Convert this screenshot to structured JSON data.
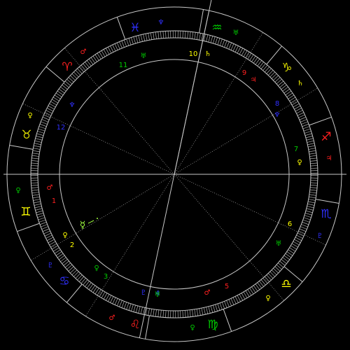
{
  "colors": {
    "background": "#000000",
    "ring": "#c8c8c8",
    "fire": "#ff2020",
    "earth": "#00cc00",
    "air": "#ffff00",
    "water": "#2020ff",
    "pointer": "#a0ff40"
  },
  "zodiac": [
    {
      "name": "aries",
      "glyph": "♈",
      "color": "#ff2020"
    },
    {
      "name": "taurus",
      "glyph": "♉",
      "color": "#dddd00"
    },
    {
      "name": "gemini",
      "glyph": "♊",
      "color": "#ffff00"
    },
    {
      "name": "cancer",
      "glyph": "♋",
      "color": "#3030ff"
    },
    {
      "name": "leo",
      "glyph": "♌",
      "color": "#ff2020"
    },
    {
      "name": "virgo",
      "glyph": "♍",
      "color": "#00cc00"
    },
    {
      "name": "libra",
      "glyph": "♎",
      "color": "#ffff00"
    },
    {
      "name": "scorpio",
      "glyph": "♏",
      "color": "#3030ff"
    },
    {
      "name": "sagittarius",
      "glyph": "♐",
      "color": "#ff2020"
    },
    {
      "name": "capricorn",
      "glyph": "♑",
      "color": "#dddd00"
    },
    {
      "name": "aquarius",
      "glyph": "♒",
      "color": "#00cc00"
    },
    {
      "name": "pisces",
      "glyph": "♓",
      "color": "#3030ff"
    }
  ],
  "houses": [
    {
      "number": "1",
      "color": "#ff2020"
    },
    {
      "number": "2",
      "color": "#ffff00"
    },
    {
      "number": "3",
      "color": "#00cc00"
    },
    {
      "number": "4",
      "color": "#3030ff"
    },
    {
      "number": "5",
      "color": "#ff2020"
    },
    {
      "number": "6",
      "color": "#ffff00"
    },
    {
      "number": "7",
      "color": "#00cc00"
    },
    {
      "number": "8",
      "color": "#3030ff"
    },
    {
      "number": "9",
      "color": "#ff2020"
    },
    {
      "number": "10",
      "color": "#ffff00"
    },
    {
      "number": "11",
      "color": "#00cc00"
    },
    {
      "number": "12",
      "color": "#3030ff"
    }
  ],
  "planets": [
    {
      "name": "mars",
      "glyph": "♂",
      "color": "#ff2020"
    },
    {
      "name": "venus",
      "glyph": "♀",
      "color": "#ffff00"
    },
    {
      "name": "mercury",
      "glyph": "☿",
      "color": "#a0ff40"
    },
    {
      "name": "saturn",
      "glyph": "♄",
      "color": "#ffff00"
    },
    {
      "name": "jupiter",
      "glyph": "♃",
      "color": "#ff2020"
    },
    {
      "name": "neptune",
      "glyph": "♆",
      "color": "#3030ff"
    },
    {
      "name": "uranus",
      "glyph": "♅",
      "color": "#00cc00"
    },
    {
      "name": "pluto",
      "glyph": "♇",
      "color": "#3030ff"
    }
  ]
}
